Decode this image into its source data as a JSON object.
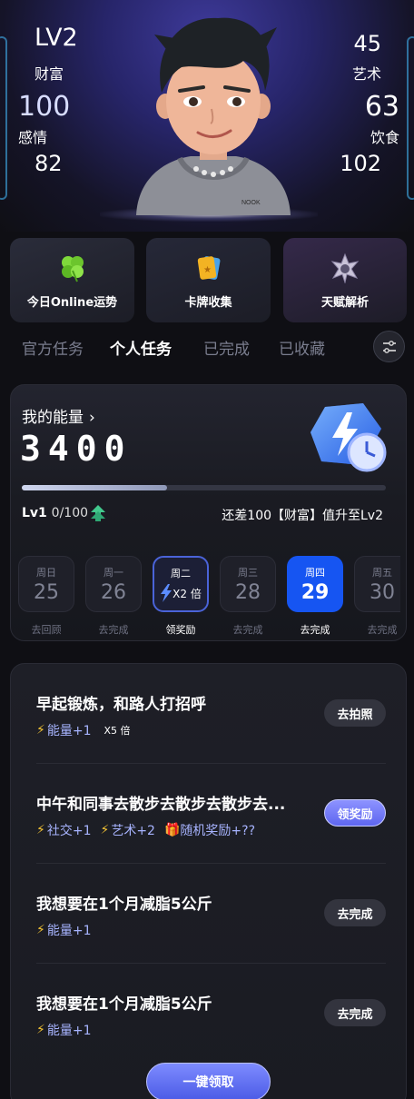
{
  "header": {
    "level": "LV2",
    "stats": {
      "wealth_label": "财富",
      "emotion_value": "100",
      "emotion_label": "感情",
      "left_bottom_value": "82",
      "art_value": "45",
      "art_label": "艺术",
      "diet_value": "63",
      "diet_label": "饮食",
      "right_bottom_value": "102"
    },
    "avatar_hoodie_text": "NOOK"
  },
  "features": [
    {
      "label": "今日Online运势",
      "icon": "clover-icon"
    },
    {
      "label": "卡牌收集",
      "icon": "card-icon"
    },
    {
      "label": "天赋解析",
      "icon": "talent-gem-icon"
    }
  ],
  "tabs": [
    {
      "label": "官方任务",
      "active": false
    },
    {
      "label": "个人任务",
      "active": true
    },
    {
      "label": "已完成",
      "active": false
    },
    {
      "label": "已收藏",
      "active": false
    }
  ],
  "energy": {
    "title": "我的能量",
    "value": "3400",
    "progress": 0.4,
    "level_text": "Lv1",
    "level_progress": "0/100",
    "need_text": "还差100【财富】值升至Lv2"
  },
  "days": [
    {
      "name": "周日",
      "num": "25",
      "status": "去回顾",
      "state": "past"
    },
    {
      "name": "周一",
      "num": "26",
      "status": "去完成",
      "state": "past"
    },
    {
      "name": "周二",
      "num": "",
      "multiplier": "X2 倍",
      "status": "领奖励",
      "state": "reward"
    },
    {
      "name": "周三",
      "num": "28",
      "status": "去完成",
      "state": "past"
    },
    {
      "name": "周四",
      "num": "29",
      "status": "去完成",
      "state": "today"
    },
    {
      "name": "周五",
      "num": "30",
      "status": "去完成",
      "state": "future"
    }
  ],
  "tasks": [
    {
      "title": "早起锻炼，和路人打招呼",
      "tags": [
        {
          "text": "能量+1"
        }
      ],
      "multiplier": "X5 倍",
      "button": "去拍照"
    },
    {
      "title": "中午和同事去散步去散步去散步去...",
      "tags": [
        {
          "text": "社交+1"
        },
        {
          "text": "艺术+2"
        }
      ],
      "gift": "随机奖励+??",
      "button": "领奖励"
    },
    {
      "title": "我想要在1个月减脂5公斤",
      "tags": [
        {
          "text": "能量+1"
        }
      ],
      "button": "去完成"
    },
    {
      "title": "我想要在1个月减脂5公斤",
      "tags": [
        {
          "text": "能量+1"
        }
      ],
      "button": "去完成"
    }
  ],
  "claim_all": "一键领取",
  "colors": {
    "accent_blue": "#1655f2",
    "tag_blue": "#a7b4ff",
    "bolt_yellow": "#f6c534"
  }
}
